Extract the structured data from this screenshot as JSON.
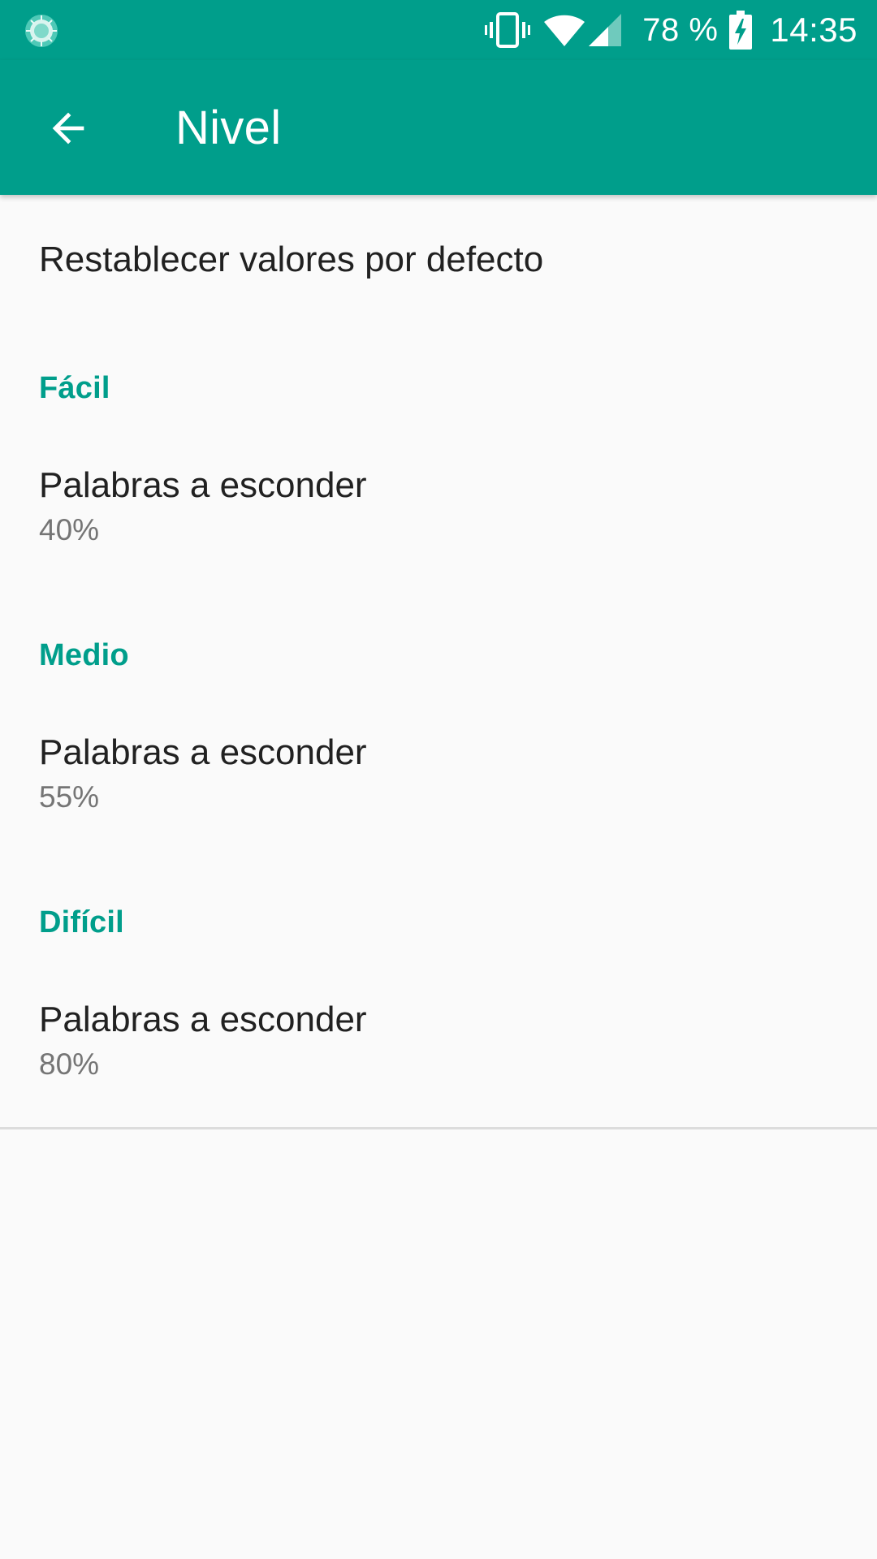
{
  "status_bar": {
    "battery_percent": "78 %",
    "time": "14:35",
    "icons": [
      "notification-app-icon",
      "vibrate-icon",
      "wifi-icon",
      "cell-signal-icon",
      "battery-charging-icon"
    ]
  },
  "app_bar": {
    "title": "Nivel",
    "back_icon": "arrow-back-icon"
  },
  "colors": {
    "primary": "#009e8b",
    "category_text": "#009e8b",
    "background": "#fafafa",
    "text_primary": "#212121",
    "text_secondary": "#757575"
  },
  "preferences": {
    "reset_label": "Restablecer valores por defecto",
    "categories": [
      {
        "title": "Fácil",
        "item_title": "Palabras a esconder",
        "item_summary": "40%"
      },
      {
        "title": "Medio",
        "item_title": "Palabras a esconder",
        "item_summary": "55%"
      },
      {
        "title": "Difícil",
        "item_title": "Palabras a esconder",
        "item_summary": "80%"
      }
    ]
  }
}
